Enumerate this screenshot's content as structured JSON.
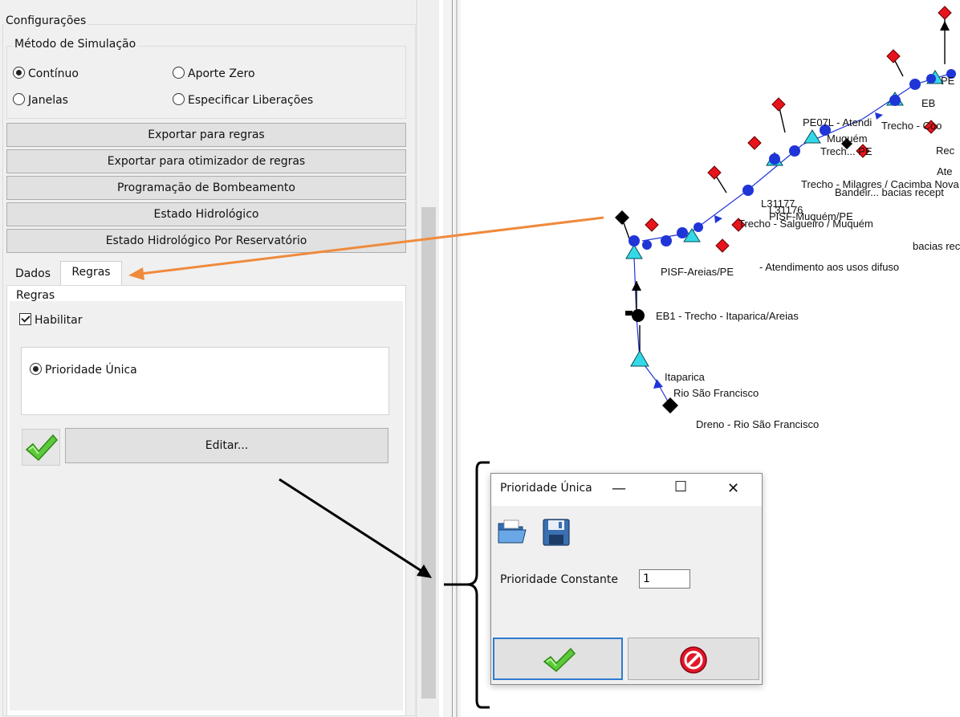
{
  "config": {
    "header": "Configurações",
    "sim_method": {
      "title": "Método de Simulação",
      "options": [
        {
          "label": "Contínuo",
          "selected": true
        },
        {
          "label": "Aporte Zero",
          "selected": false
        },
        {
          "label": "Janelas",
          "selected": false
        },
        {
          "label": "Especificar Liberações",
          "selected": false
        }
      ]
    },
    "buttons": [
      "Exportar para regras",
      "Exportar para otimizador de regras",
      "Programação de Bombeamento",
      "Estado Hidrológico",
      "Estado Hidrológico Por Reservatório"
    ],
    "tabs": [
      {
        "label": "Dados",
        "active": false
      },
      {
        "label": "Regras",
        "active": true
      }
    ],
    "rules": {
      "group_title": "Regras",
      "enable_label": "Habilitar",
      "enable_checked": true,
      "priority_option": "Prioridade Única",
      "edit_button": "Editar..."
    }
  },
  "dialog": {
    "title": "Prioridade Única",
    "controls": {
      "minimize": "—",
      "maximize": "☐",
      "close": "✕"
    },
    "field_label": "Prioridade Constante",
    "field_value": "1"
  },
  "map": {
    "labels": {
      "eb1": "EB1 - Trecho - Itaparica/Areias",
      "itaparica": "Itaparica",
      "rio": "Rio São Francisco",
      "dreno": "Dreno - Rio São Francisco",
      "pisf_areias": "PISF-Areias/PE",
      "atend_difusos": "- Atendimento aos usos difuso",
      "bacias_rec": "bacias rec",
      "trecho_salgueiro": "Trecho - Salgueiro / Muquém",
      "pisf_muquem": "PISF-Muquém/PE",
      "l1": "L31177",
      "l2": "L31176",
      "bacias_recept": "Bandeir... bacias recept",
      "trecho_milagres": "Trecho - Milagres / Cacimba Nova",
      "pe07l": "PE07L - Atendi",
      "muquem": "Muquém",
      "trecho_pe": "Trech... PE",
      "ateh": "Ate",
      "pe_top": "PE",
      "eb_top": "EB",
      "rec_top": "Rec",
      "trecho_top": "Trecho - Coo"
    }
  },
  "colors": {
    "arrow_orange": "#ef8a3c",
    "node_blue": "#1f35d8",
    "node_cyan": "#33d9e8",
    "node_red": "#e8141c",
    "accept_green": "#4caf20",
    "cancel_red": "#e0182a"
  }
}
